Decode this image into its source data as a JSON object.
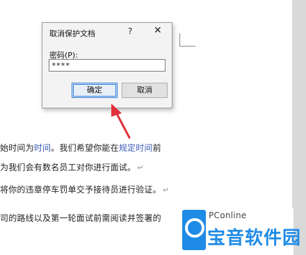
{
  "dialog": {
    "title": "取消保护文档",
    "help": "?",
    "close": "✕",
    "password_label": "密码(P):",
    "password_value": "****",
    "ok_label": "确定",
    "cancel_label": "取消"
  },
  "document": {
    "line1_a": "始时间为",
    "line1_b": "时间",
    "line1_c": "。我们希望你能在",
    "line1_d": "规定时间",
    "line1_e": "前",
    "line2": "为我们会有数名员工对你进行面试。",
    "line3": "将你的违章停车罚单交予接待员进行验证。",
    "line4": "司的路线以及第一轮面试前需阅读并签署的",
    "return_mark": "↵"
  },
  "watermark": {
    "name": "PConline",
    "chars": "宝音软件园"
  },
  "colors": {
    "accent": "#2c7ad6",
    "arrow": "#e0303a",
    "link_text": "#3a5bb5"
  }
}
